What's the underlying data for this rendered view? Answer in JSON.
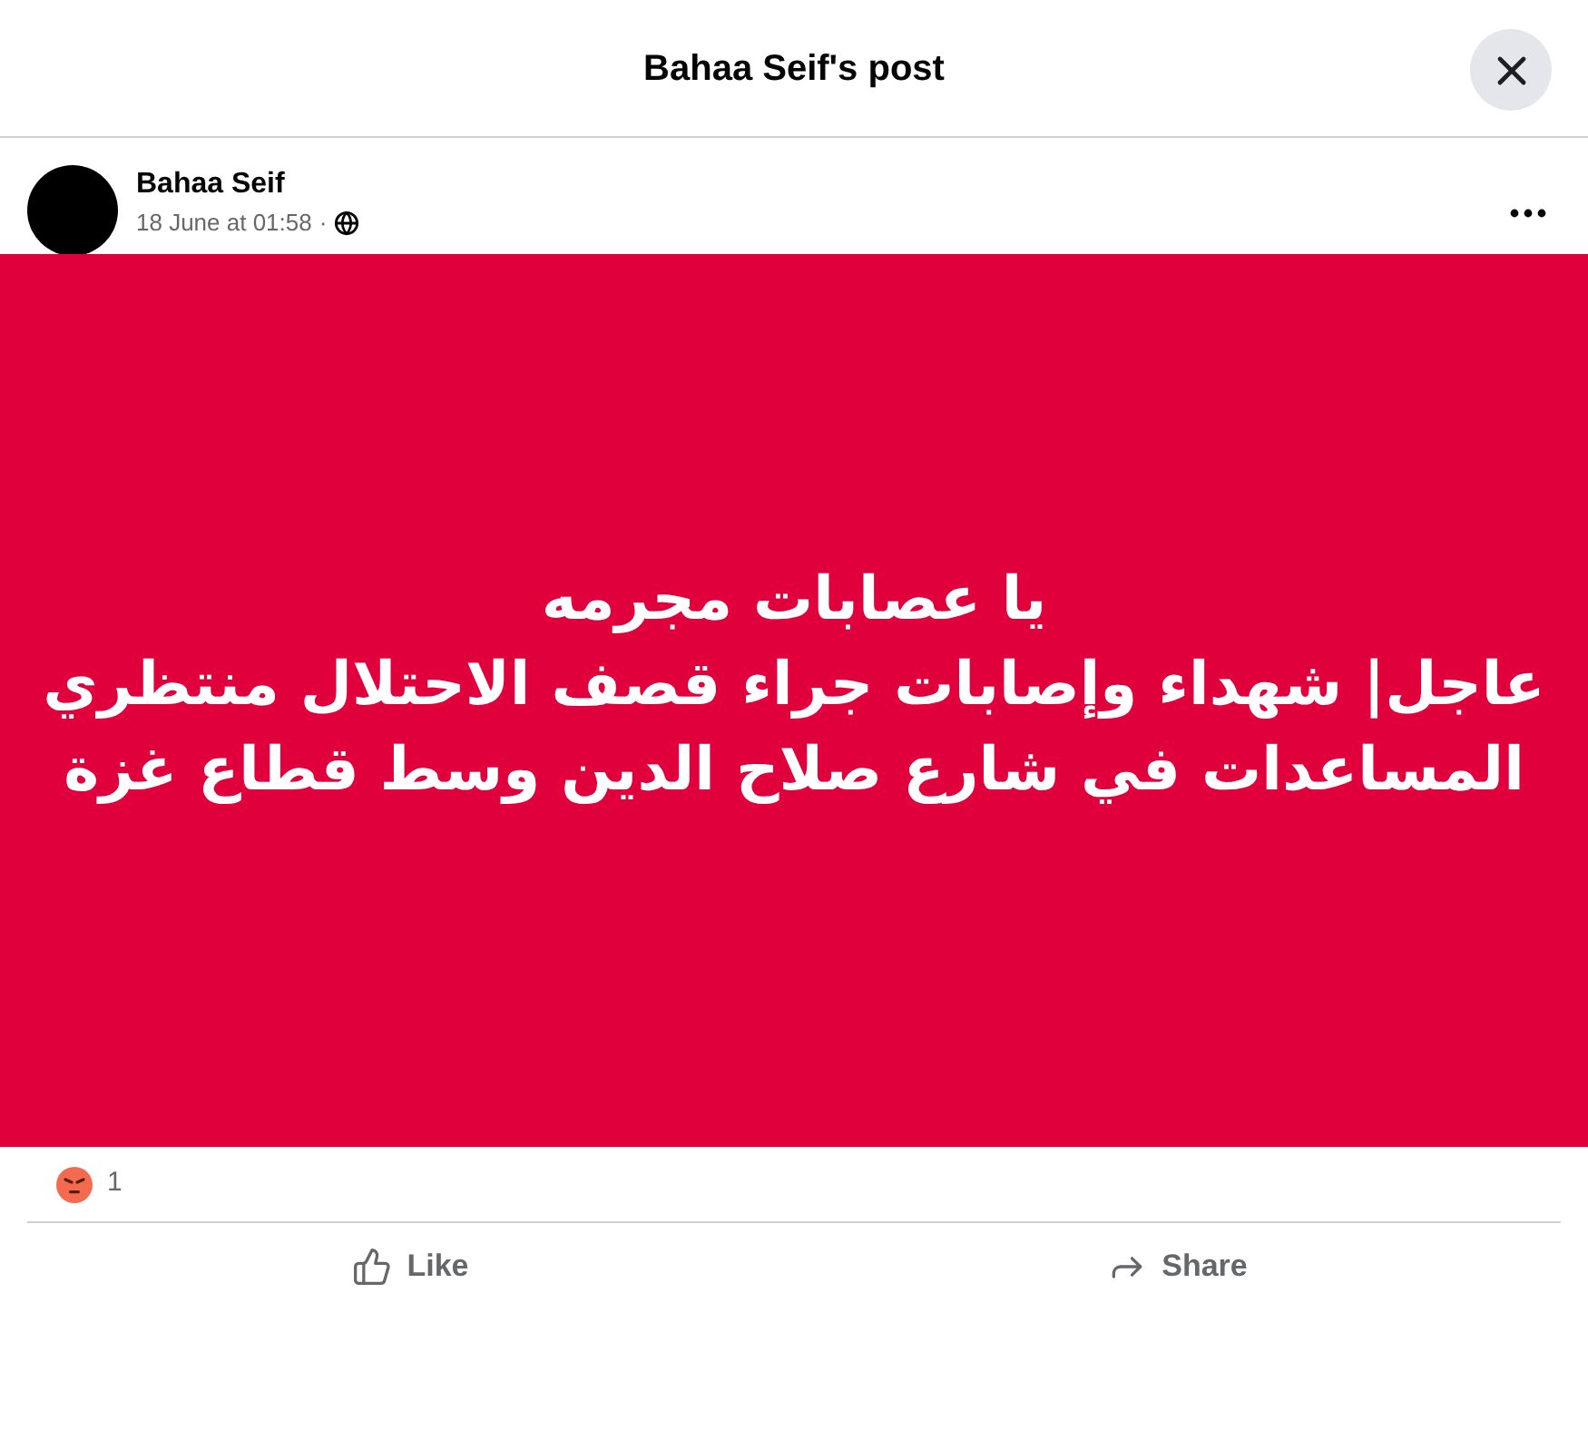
{
  "dialog": {
    "title": "Bahaa Seif's post"
  },
  "post": {
    "author": "Bahaa Seif",
    "timestamp": "18 June at 01:58",
    "separator": "·",
    "text_lines": [
      "يا عصابات مجرمه",
      "عاجل| شهداء وإصابات جراء قصف الاحتلال منتظري",
      "المساعدات في شارع صلاح الدين وسط قطاع غزة"
    ]
  },
  "reactions": {
    "count": "1"
  },
  "like_button": {
    "label": "Like"
  },
  "share_button": {
    "label": "Share"
  }
}
